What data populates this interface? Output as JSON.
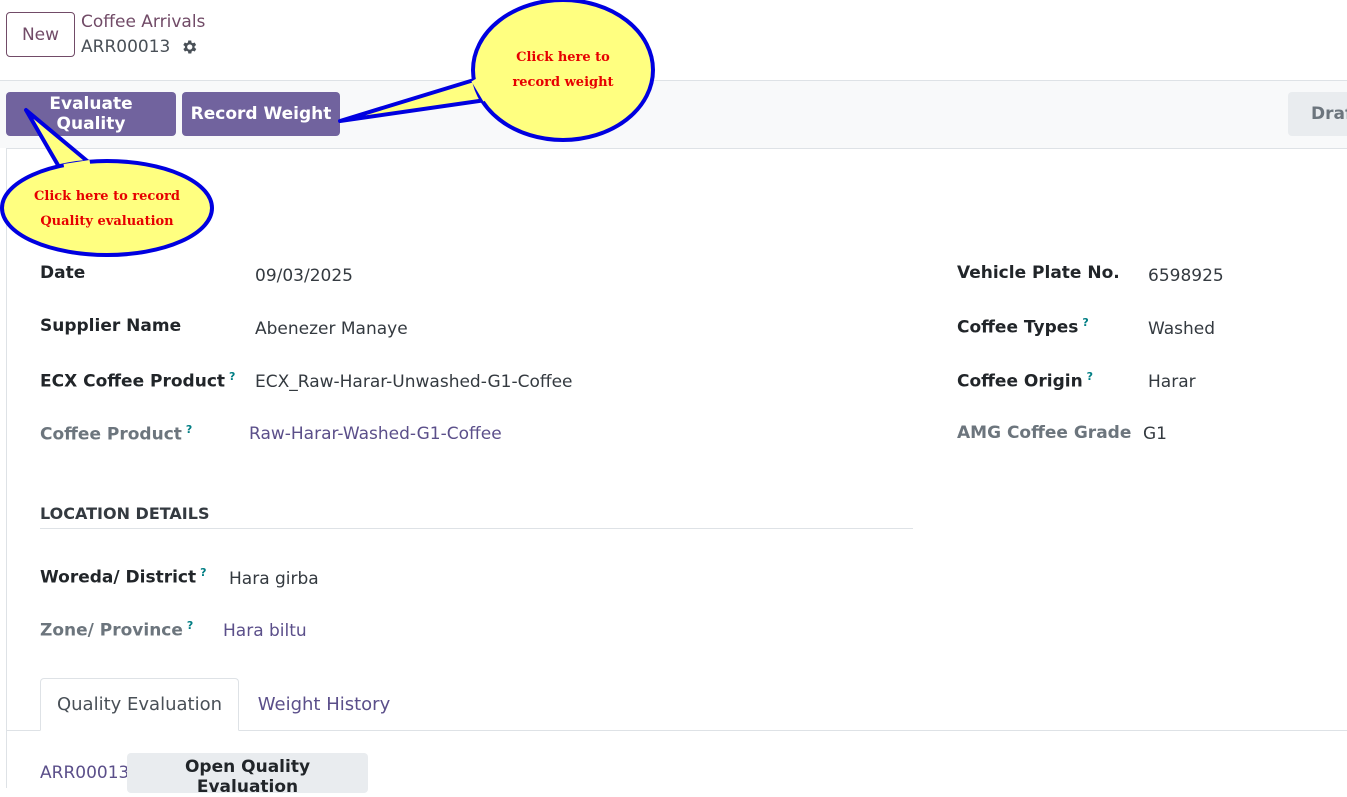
{
  "header": {
    "new_label": "New",
    "breadcrumb_parent": "Coffee Arrivals",
    "record_ref": "ARR00013"
  },
  "statusbar": {
    "evaluate_label": "Evaluate Quality",
    "record_weight_label": "Record Weight",
    "status_label": "Draft"
  },
  "form": {
    "date_label": "Date",
    "date_value": "09/03/2025",
    "supplier_label": "Supplier Name",
    "supplier_value": "Abenezer Manaye",
    "ecx_label": "ECX Coffee Product",
    "ecx_value": "ECX_Raw-Harar-Unwashed-G1-Coffee",
    "product_label": "Coffee Product",
    "product_value": "Raw-Harar-Washed-G1-Coffee",
    "plate_label": "Vehicle Plate No.",
    "plate_value": "6598925",
    "types_label": "Coffee Types",
    "types_value": "Washed",
    "origin_label": "Coffee Origin",
    "origin_value": "Harar",
    "grade_label": "AMG Coffee Grade",
    "grade_value": "G1",
    "help_mark": "?"
  },
  "location": {
    "section_title": "LOCATION DETAILS",
    "woreda_label": "Woreda/ District",
    "woreda_value": "Hara girba",
    "zone_label": "Zone/ Province",
    "zone_value": "Hara biltu"
  },
  "tabs": [
    {
      "label": "Quality Evaluation",
      "active": true
    },
    {
      "label": "Weight History",
      "active": false
    }
  ],
  "quality_tab": {
    "ref": "ARR00013",
    "open_button": "Open Quality Evaluation"
  },
  "callouts": {
    "weight": "Click here to\nrecord weight",
    "quality": "Click here to record\nQuality evaluation"
  },
  "colors": {
    "primary": "#71639e",
    "callout_fill": "#ffff80",
    "callout_border": "#0000e0",
    "callout_text": "#e60000"
  },
  "icons": [
    "gear-icon"
  ]
}
